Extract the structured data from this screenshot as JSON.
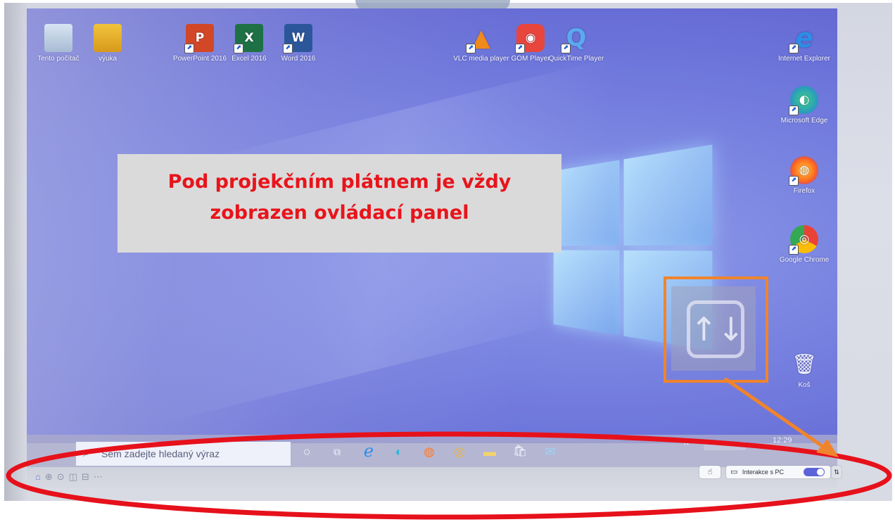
{
  "desktop": {
    "icons_top": [
      {
        "name": "Tento počítač",
        "glyph": "🖥"
      },
      {
        "name": "výuka",
        "glyph": "👤"
      },
      {
        "name": "PowerPoint 2016",
        "glyph": "P"
      },
      {
        "name": "Excel 2016",
        "glyph": "X"
      },
      {
        "name": "Word 2016",
        "glyph": "W"
      },
      {
        "name": "VLC media player",
        "glyph": "▲"
      },
      {
        "name": "GOM Player",
        "glyph": "◉"
      },
      {
        "name": "QuickTime Player",
        "glyph": "Q"
      }
    ],
    "icons_right": [
      {
        "name": "Internet Explorer",
        "glyph": "e"
      },
      {
        "name": "Microsoft Edge",
        "glyph": "◐"
      },
      {
        "name": "Firefox",
        "glyph": "◍"
      },
      {
        "name": "Google Chrome",
        "glyph": "◎"
      },
      {
        "name": "Koš",
        "glyph": "🗑"
      }
    ],
    "shortcut_mark": "⬈"
  },
  "banner": {
    "line1": "Pod projekčním plátnem je vždy",
    "line2": "zobrazen ovládací panel"
  },
  "toggle_widget": {
    "glyph": "↑↓"
  },
  "taskbar": {
    "search_icon": "⌕",
    "search_placeholder": "Sem zadejte hledaný výraz",
    "cortana_icon": "○",
    "taskview_icon": "⧉",
    "apps": [
      "ℯ",
      "◐",
      "◍",
      "◎",
      "▬",
      "🛍",
      "✉"
    ],
    "tray_chevron": "^",
    "tray_clock": "12:29"
  },
  "control_panel": {
    "touch_icon": "☝",
    "interaction_label": "Interakce s PC",
    "toggle_state": "on",
    "switch_icon": "⇅",
    "bottom_icons": [
      "⌂",
      "⊕",
      "⊙",
      "◫",
      "⊟",
      "⋯"
    ]
  },
  "colors": {
    "banner_text": "#e8141b",
    "annotation_ellipse": "#e6111b",
    "annotation_arrow": "#f0842c",
    "toggle_on": "#5c63d8"
  }
}
